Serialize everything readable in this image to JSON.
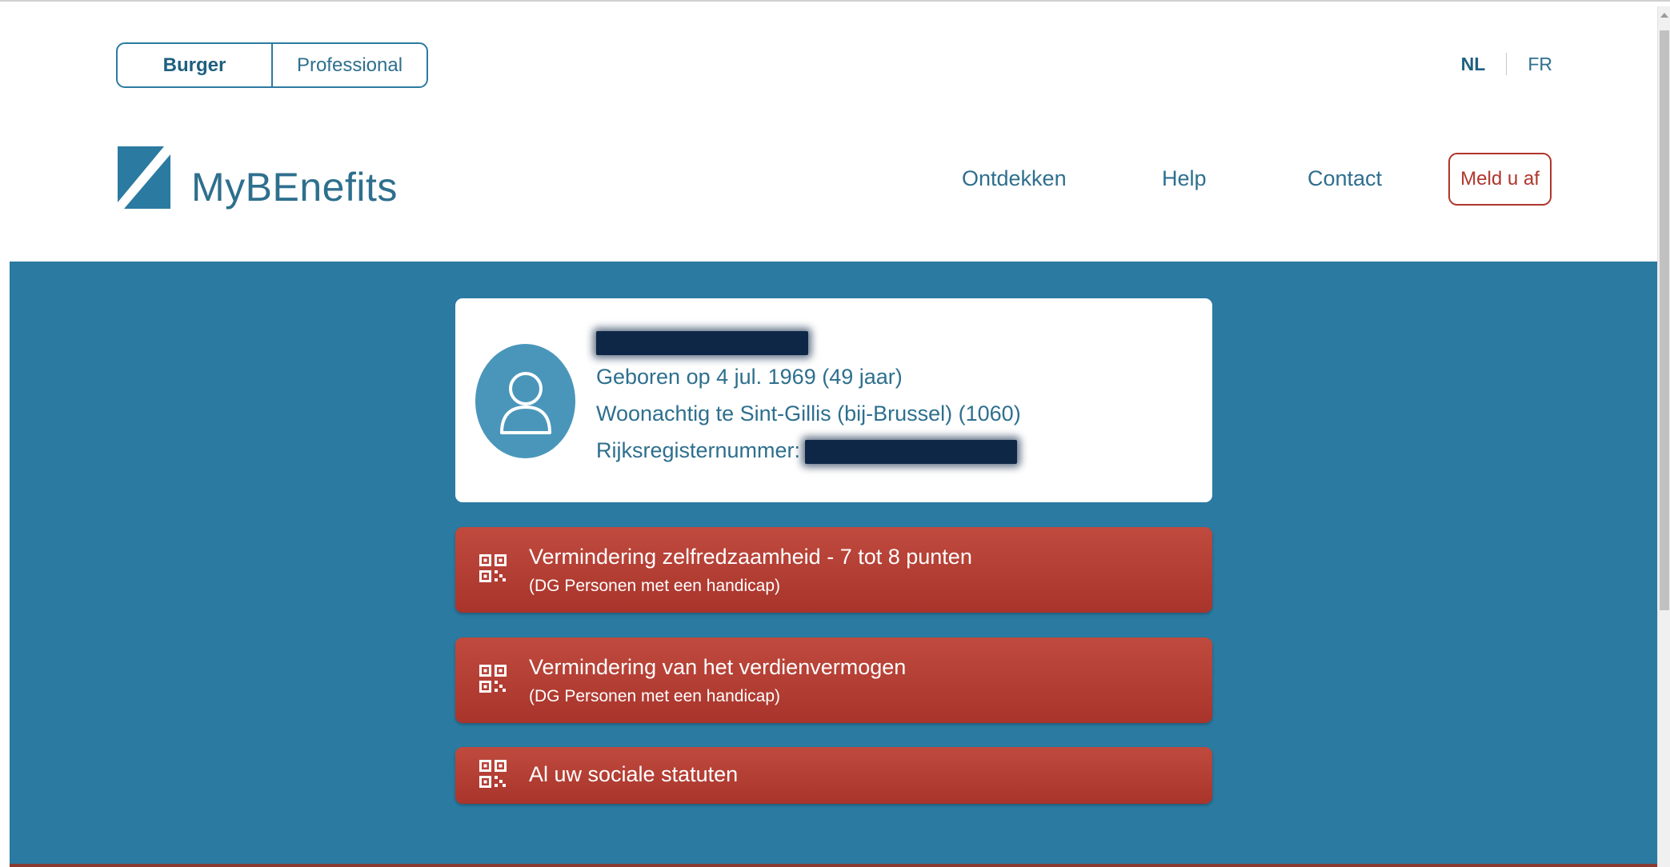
{
  "audience": {
    "burger": "Burger",
    "professional": "Professional"
  },
  "language": {
    "nl": "NL",
    "fr": "FR"
  },
  "logo": {
    "text": "MyBEnefits"
  },
  "nav": {
    "ontdekken": "Ontdekken",
    "help": "Help",
    "contact": "Contact",
    "logout": "Meld u af"
  },
  "profile": {
    "birth": "Geboren op 4 jul. 1969 (49 jaar)",
    "residence": "Woonachtig te Sint-Gillis (bij-Brussel) (1060)",
    "rrn_label": "Rijksregisternummer:"
  },
  "statuses": [
    {
      "title": "Vermindering zelfredzaamheid - 7 tot 8 punten",
      "sub": "(DG Personen met een handicap)"
    },
    {
      "title": "Vermindering van het verdienvermogen",
      "sub": "(DG Personen met een handicap)"
    },
    {
      "title": "Al uw sociale statuten"
    }
  ],
  "colors": {
    "brand_blue": "#2a7aa1",
    "text_blue": "#2e6f8e",
    "status_red": "#b0352c",
    "redaction": "#0f2747"
  },
  "icons": [
    "user-avatar-icon",
    "qr-code-icon",
    "mybenefits-logo-mark"
  ]
}
